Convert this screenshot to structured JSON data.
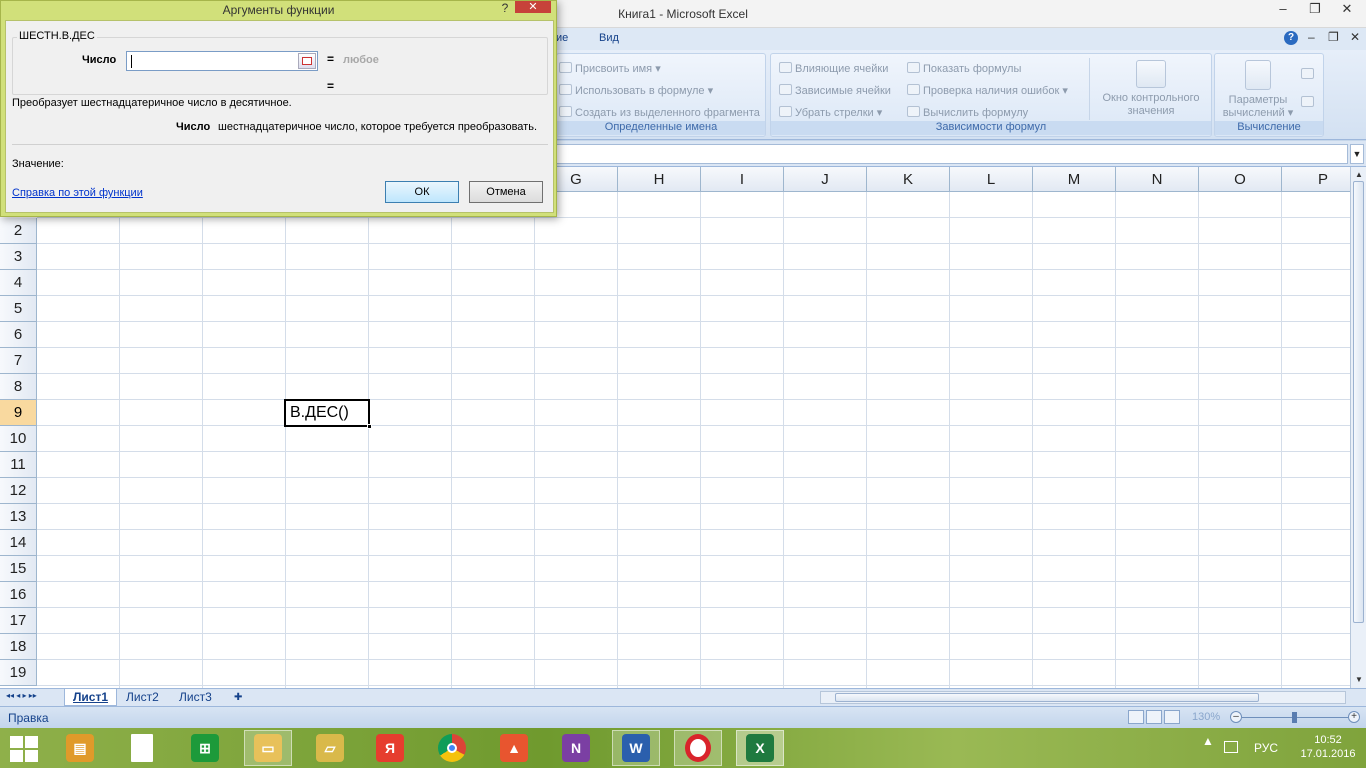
{
  "window": {
    "title": "Книга1 - Microsoft Excel",
    "minimize": "–",
    "restore": "❐",
    "close": "✕"
  },
  "ribbon": {
    "tabs": [
      "ие",
      "Вид"
    ],
    "help": "?",
    "names_group": {
      "label": "Определенные имена",
      "assign_name": "Присвоить имя ▾",
      "use_in_formula": "Использовать в формуле ▾",
      "create_from_selection": "Создать из выделенного фрагмента"
    },
    "audit_group": {
      "label": "Зависимости формул",
      "trace_precedents": "Влияющие ячейки",
      "trace_dependents": "Зависимые ячейки",
      "remove_arrows": "Убрать стрелки ▾",
      "show_formulas": "Показать формулы",
      "error_checking": "Проверка наличия ошибок ▾",
      "evaluate_formula": "Вычислить формулу",
      "watch_window": "Окно контрольного значения"
    },
    "calc_group": {
      "label": "Вычисление",
      "calc_options": "Параметры вычислений ▾"
    }
  },
  "grid": {
    "columns": [
      "G",
      "H",
      "I",
      "J",
      "K",
      "L",
      "M",
      "N",
      "O",
      "P"
    ],
    "rows": [
      "2",
      "3",
      "4",
      "5",
      "6",
      "7",
      "8",
      "9",
      "10",
      "11",
      "12",
      "13",
      "14",
      "15",
      "16",
      "17",
      "18",
      "19"
    ],
    "active_row": "9",
    "active_cell_text": "В.ДЕС()"
  },
  "sheets": {
    "tabs": [
      "Лист1",
      "Лист2",
      "Лист3"
    ],
    "active": "Лист1",
    "nav": "◂◂ ◂ ▸ ▸▸"
  },
  "status": {
    "mode": "Правка",
    "zoom": "130%"
  },
  "dialog": {
    "title": "Аргументы функции",
    "help": "?",
    "close": "✕",
    "function_name": "ШЕСТН.В.ДЕС",
    "arg_label": "Число",
    "arg_input_value": "",
    "eq1": "=",
    "arg_value": "любое",
    "eq2": "=",
    "description": "Преобразует шестнадцатеричное число в десятичное.",
    "param_name": "Число",
    "param_description": "шестнадцатеричное число, которое требуется преобразовать.",
    "value_label": "Значение:",
    "help_link": "Справка по этой функции",
    "ok": "ОК",
    "cancel": "Отмена"
  },
  "taskbar": {
    "apps": [
      "file-manager",
      "document",
      "store",
      "explorer",
      "folder",
      "yandex",
      "chrome",
      "photos",
      "onenote",
      "word",
      "opera",
      "excel"
    ],
    "tray_arrow": "▲",
    "language": "РУС",
    "time": "10:52",
    "date": "17.01.2016"
  }
}
